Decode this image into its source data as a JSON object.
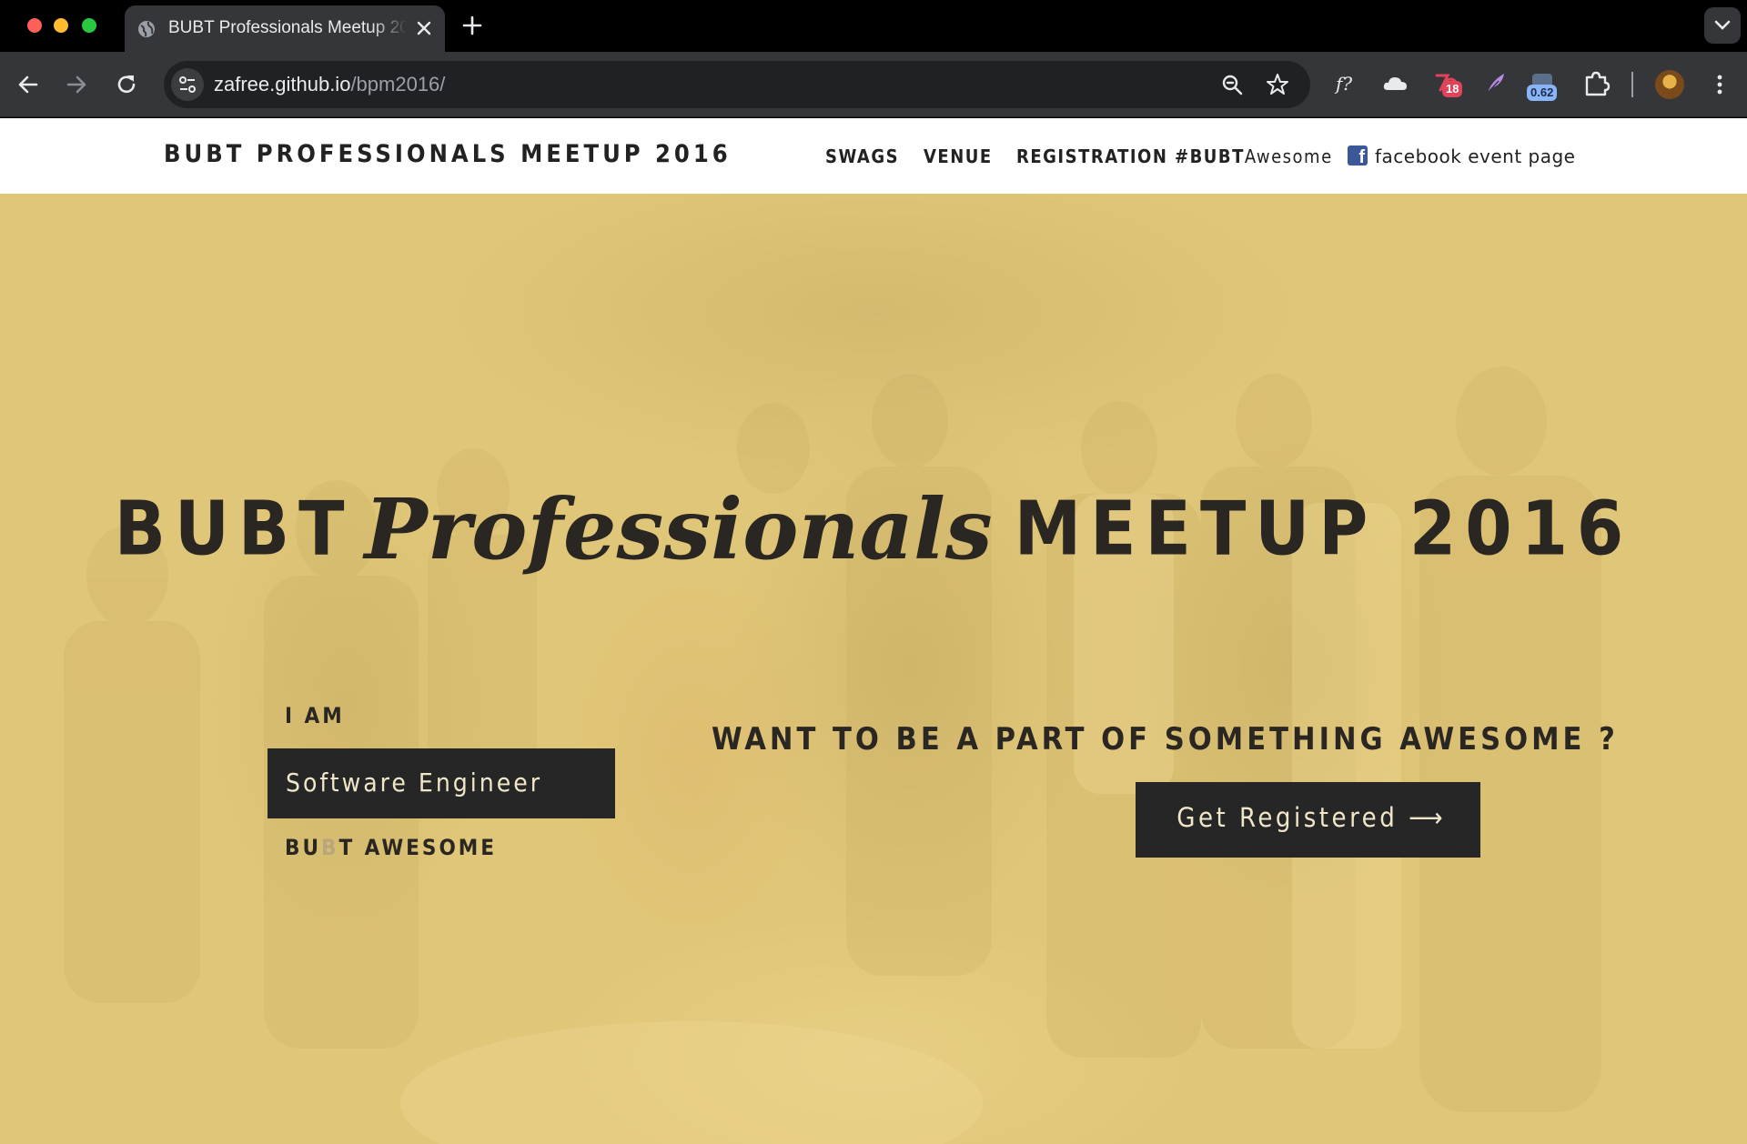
{
  "browser": {
    "tab_title": "BUBT Professionals Meetup 2016",
    "url_host": "zafree.github.io",
    "url_path": "/bpm2016/",
    "extension_badges": {
      "red_badge": "18",
      "blue_badge": "0.62"
    },
    "icons": [
      "globe-icon",
      "close-icon",
      "plus-icon",
      "chevron-down-icon",
      "back-icon",
      "forward-icon",
      "reload-icon",
      "site-info-icon",
      "zoom-icon",
      "star-icon",
      "fx-extension-icon",
      "cloud-extension-icon",
      "red-extension-icon",
      "feather-extension-icon",
      "blue-extension-icon",
      "puzzle-icon",
      "avatar",
      "kebab-menu-icon"
    ]
  },
  "navbar": {
    "brand": "BUBT PROFESSIONALS MEETUP 2016",
    "links": {
      "swags": "SWAGS",
      "venue": "VENUE",
      "registration": "REGISTRATION",
      "hashtag_bold": "#BUBT",
      "hashtag_light": "Awesome"
    },
    "facebook": "facebook event page",
    "facebook_color": "#3b5998"
  },
  "hero": {
    "title_left": "BUBT",
    "title_script": "Professionals",
    "title_right": "MEETUP 2016",
    "i_am": "I AM",
    "role": "Software Engineer",
    "awesome_a": "BU",
    "awesome_b": "B",
    "awesome_c": "T AWESOME",
    "cta": "WANT TO BE A PART OF SOMETHING AWESOME ?",
    "register": "Get Registered ⟶",
    "overlay_color": "#e8cd7d",
    "dark_color": "#262626"
  }
}
